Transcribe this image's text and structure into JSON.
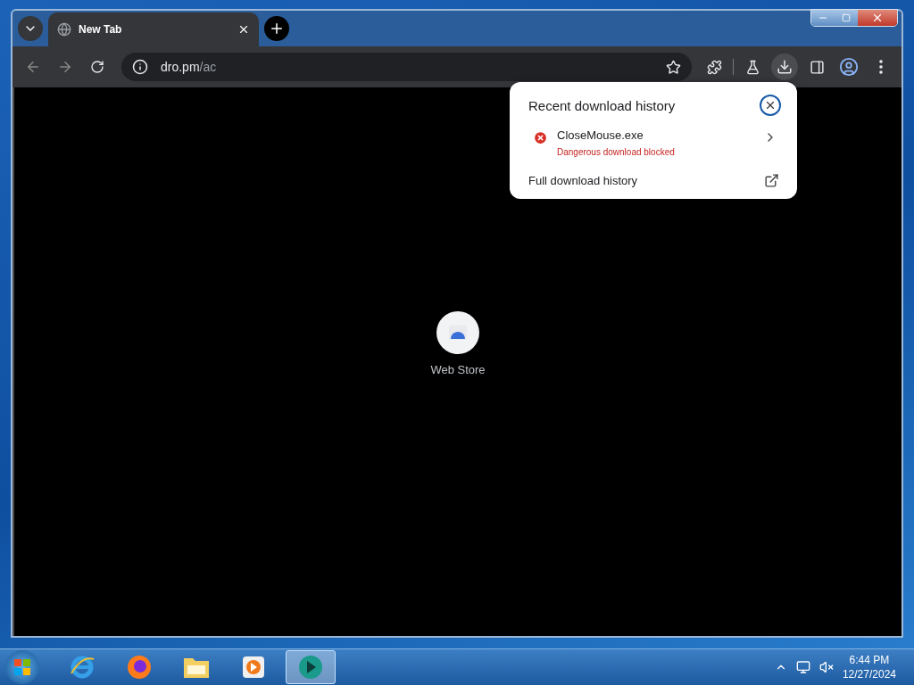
{
  "tabs": [
    {
      "title": "New Tab",
      "selected": true
    }
  ],
  "address_bar": {
    "host": "dro.pm",
    "path": "/ac"
  },
  "download_popup": {
    "title": "Recent download history",
    "items": [
      {
        "name": "CloseMouse.exe",
        "status": "Dangerous download blocked",
        "blocked": true
      }
    ],
    "footer_link": "Full download history"
  },
  "shortcuts": [
    {
      "label": "Web Store"
    }
  ],
  "taskbar": {
    "apps": [
      {
        "kind": "ie",
        "selected": false
      },
      {
        "kind": "firefox",
        "selected": false
      },
      {
        "kind": "explorer",
        "selected": false
      },
      {
        "kind": "media",
        "selected": false
      },
      {
        "kind": "chrome",
        "selected": true
      }
    ],
    "time": "6:44 PM",
    "date": "12/27/2024"
  }
}
